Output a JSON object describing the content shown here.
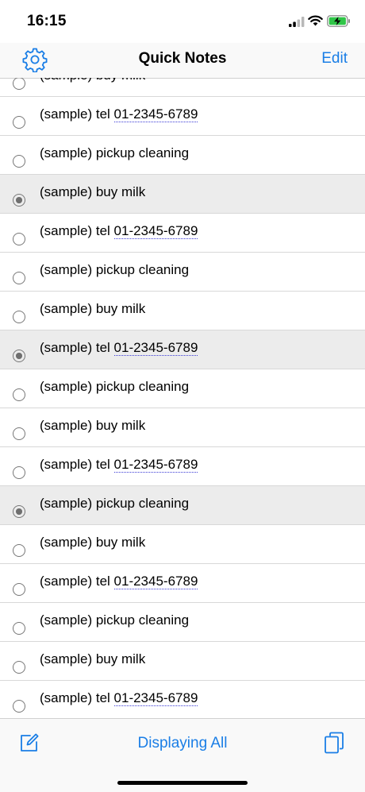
{
  "status": {
    "time": "16:15"
  },
  "nav": {
    "title": "Quick Notes",
    "edit_label": "Edit"
  },
  "notes": [
    {
      "prefix": "(sample) buy milk",
      "phone": "",
      "checked": false
    },
    {
      "prefix": "(sample) tel ",
      "phone": "01-2345-6789",
      "checked": false
    },
    {
      "prefix": "(sample) pickup cleaning",
      "phone": "",
      "checked": false
    },
    {
      "prefix": "(sample) buy milk",
      "phone": "",
      "checked": true
    },
    {
      "prefix": "(sample) tel ",
      "phone": "01-2345-6789",
      "checked": false
    },
    {
      "prefix": "(sample) pickup cleaning",
      "phone": "",
      "checked": false
    },
    {
      "prefix": "(sample) buy milk",
      "phone": "",
      "checked": false
    },
    {
      "prefix": "(sample) tel ",
      "phone": "01-2345-6789",
      "checked": true
    },
    {
      "prefix": "(sample) pickup cleaning",
      "phone": "",
      "checked": false
    },
    {
      "prefix": "(sample) buy milk",
      "phone": "",
      "checked": false
    },
    {
      "prefix": "(sample) tel ",
      "phone": "01-2345-6789",
      "checked": false
    },
    {
      "prefix": "(sample) pickup cleaning",
      "phone": "",
      "checked": true
    },
    {
      "prefix": "(sample) buy milk",
      "phone": "",
      "checked": false
    },
    {
      "prefix": "(sample) tel ",
      "phone": "01-2345-6789",
      "checked": false
    },
    {
      "prefix": "(sample) pickup cleaning",
      "phone": "",
      "checked": false
    },
    {
      "prefix": "(sample) buy milk",
      "phone": "",
      "checked": false
    },
    {
      "prefix": "(sample) tel ",
      "phone": "01-2345-6789",
      "checked": false
    }
  ],
  "toolbar": {
    "display_mode_label": "Displaying All"
  },
  "icons": {
    "settings": "gear-icon",
    "compose": "compose-icon",
    "copy": "copy-icon"
  },
  "colors": {
    "accent": "#1a7ee6",
    "checked_row": "#ececec"
  }
}
